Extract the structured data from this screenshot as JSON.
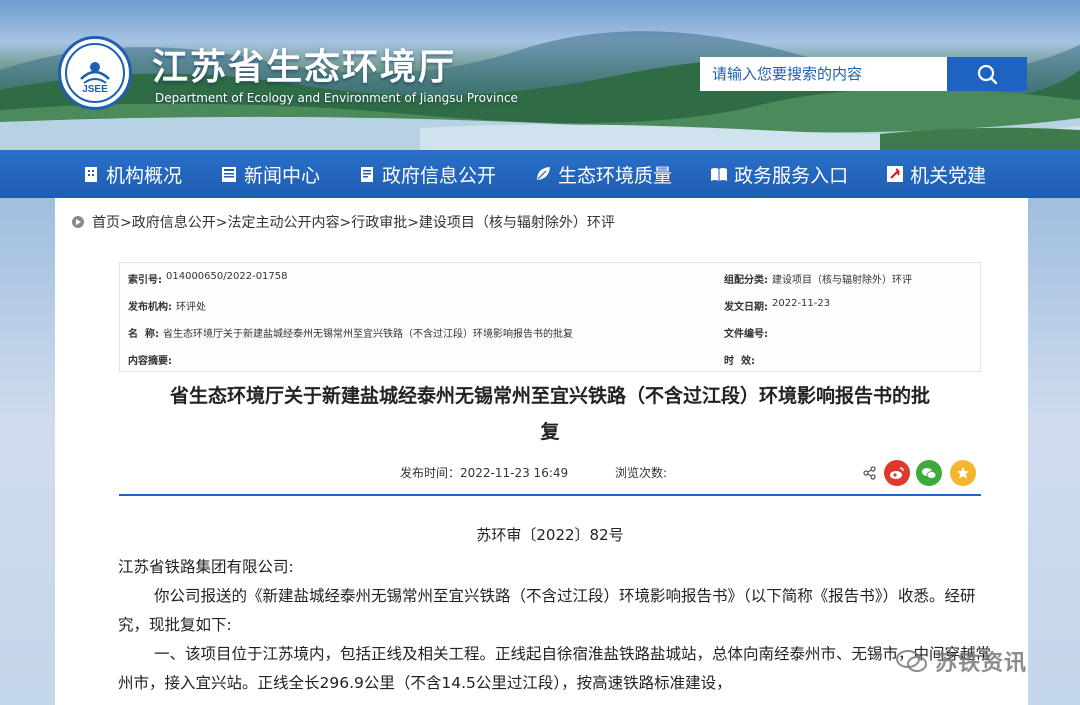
{
  "header": {
    "title": "江苏省生态环境厅",
    "subtitle": "Department of Ecology and Environment of Jiangsu Province",
    "logo_text": "JSEE",
    "search_placeholder": "请输入您要搜索的内容"
  },
  "nav": {
    "items": [
      {
        "label": "机构概况",
        "icon": "building-icon"
      },
      {
        "label": "新闻中心",
        "icon": "newspaper-icon"
      },
      {
        "label": "政府信息公开",
        "icon": "document-icon"
      },
      {
        "label": "生态环境质量",
        "icon": "leaf-icon"
      },
      {
        "label": "政务服务入口",
        "icon": "book-icon"
      },
      {
        "label": "机关党建",
        "icon": "party-emblem-icon"
      }
    ]
  },
  "breadcrumb": "首页>政府信息公开>法定主动公开内容>行政审批>建设项目（核与辐射除外）环评",
  "meta": {
    "index_label": "索引号:",
    "index_value": "014000650/2022-01758",
    "category_label": "组配分类:",
    "category_value": "建设项目（核与辐射除外）环评",
    "publisher_label": "发布机构:",
    "publisher_value": "环评处",
    "date_label": "发文日期:",
    "date_value": "2022-11-23",
    "name_label": "名  称:",
    "name_value": "省生态环境厅关于新建盐城经泰州无锡常州至宜兴铁路（不含过江段）环境影响报告书的批复",
    "docno_label": "文件编号:",
    "docno_value": "",
    "summary_label": "内容摘要:",
    "summary_value": "",
    "validity_label": "时  效:",
    "validity_value": ""
  },
  "document": {
    "title_line1": "省生态环境厅关于新建盐城经泰州无锡常州至宜兴铁路（不含过江段）环境影响报告书的批",
    "title_line2": "复",
    "publish_time": "发布时间：2022-11-23 16:49",
    "views": "浏览次数:",
    "doc_number": "苏环审〔2022〕82号",
    "salutation": "江苏省铁路集团有限公司:",
    "para1": "你公司报送的《新建盐城经泰州无锡常州至宜兴铁路（不含过江段）环境影响报告书》（以下简称《报告书》）收悉。经研究，现批复如下:",
    "para2": "一、该项目位于江苏境内，包括正线及相关工程。正线起自徐宿淮盐铁路盐城站，总体向南经泰州市、无锡市，中间穿越常州市，接入宜兴站。正线全长296.9公里（不含14.5公里过江段），按高速铁路标准建设，"
  },
  "watermark": "苏铁资讯",
  "colors": {
    "nav_bg": "#1e5db2",
    "accent": "#1f63c0",
    "weibo": "#e0382c",
    "wechat": "#3dab3a",
    "favorite": "#f2b72c"
  }
}
